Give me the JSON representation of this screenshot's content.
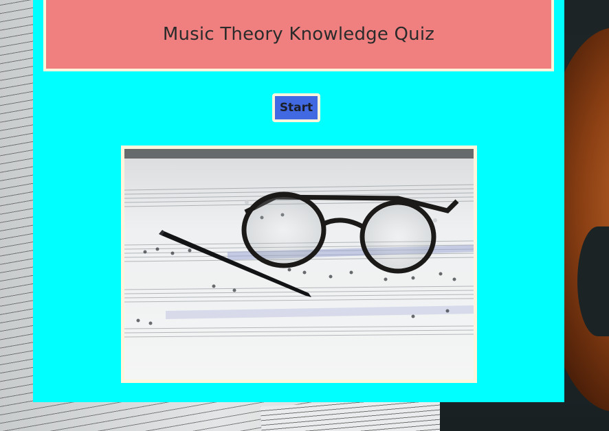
{
  "quiz": {
    "title": "Music Theory Knowledge Quiz",
    "start_label": "Start"
  },
  "image": {
    "description_icon": "glasses-pen-sheet-music-photo"
  },
  "colors": {
    "panel": "#00ffff",
    "title_bg": "#f08080",
    "button_bg": "#4169e1",
    "border": "#fdf5dc"
  }
}
